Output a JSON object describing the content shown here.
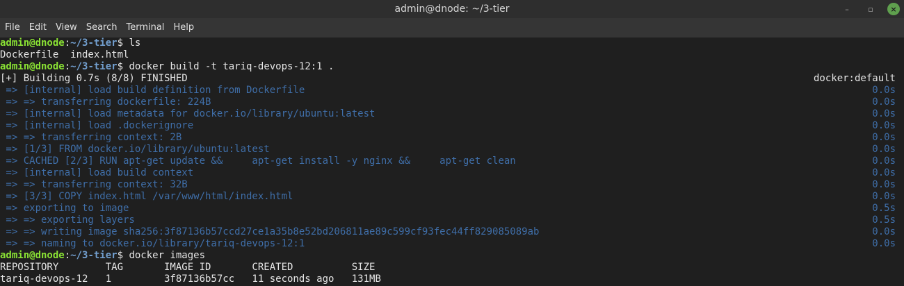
{
  "window": {
    "title": "admin@dnode: ~/3-tier",
    "controls": {
      "minimize": "–",
      "maximize": "▫",
      "close": "×"
    }
  },
  "menu": [
    "File",
    "Edit",
    "View",
    "Search",
    "Terminal",
    "Help"
  ],
  "prompt": {
    "user": "admin@dnode",
    "colon": ":",
    "path": "~/3-tier",
    "dollar": "$ "
  },
  "terminal": {
    "cmd1": "ls",
    "out1": "Dockerfile  index.html",
    "cmd2": "docker build -t tariq-devops-12:1 .",
    "build_header": "[+] Building 0.7s (8/8) FINISHED",
    "build_context": "docker:default",
    "build_steps": [
      {
        "text": " => [internal] load build definition from Dockerfile",
        "time": "0.0s"
      },
      {
        "text": " => => transferring dockerfile: 224B",
        "time": "0.0s"
      },
      {
        "text": " => [internal] load metadata for docker.io/library/ubuntu:latest",
        "time": "0.0s"
      },
      {
        "text": " => [internal] load .dockerignore",
        "time": "0.0s"
      },
      {
        "text": " => => transferring context: 2B",
        "time": "0.0s"
      },
      {
        "text": " => [1/3] FROM docker.io/library/ubuntu:latest",
        "time": "0.0s"
      },
      {
        "text": " => CACHED [2/3] RUN apt-get update &&     apt-get install -y nginx &&     apt-get clean",
        "time": "0.0s"
      },
      {
        "text": " => [internal] load build context",
        "time": "0.0s"
      },
      {
        "text": " => => transferring context: 32B",
        "time": "0.0s"
      },
      {
        "text": " => [3/3] COPY index.html /var/www/html/index.html",
        "time": "0.0s"
      },
      {
        "text": " => exporting to image",
        "time": "0.5s"
      },
      {
        "text": " => => exporting layers",
        "time": "0.5s"
      },
      {
        "text": " => => writing image sha256:3f87136b57ccd27ce1a35b8e52bd206811ae89c599cf93fec44ff829085089ab",
        "time": "0.0s"
      },
      {
        "text": " => => naming to docker.io/library/tariq-devops-12:1",
        "time": "0.0s"
      }
    ],
    "cmd3": "docker images",
    "images_header": "REPOSITORY        TAG       IMAGE ID       CREATED          SIZE",
    "images_row": "tariq-devops-12   1         3f87136b57cc   11 seconds ago   131MB"
  },
  "colors": {
    "background": "#1f1f1f",
    "prompt_user": "#8ae234",
    "prompt_path": "#729fcf",
    "dim_text": "#3f6ea8",
    "close_button": "#5fa04e"
  }
}
